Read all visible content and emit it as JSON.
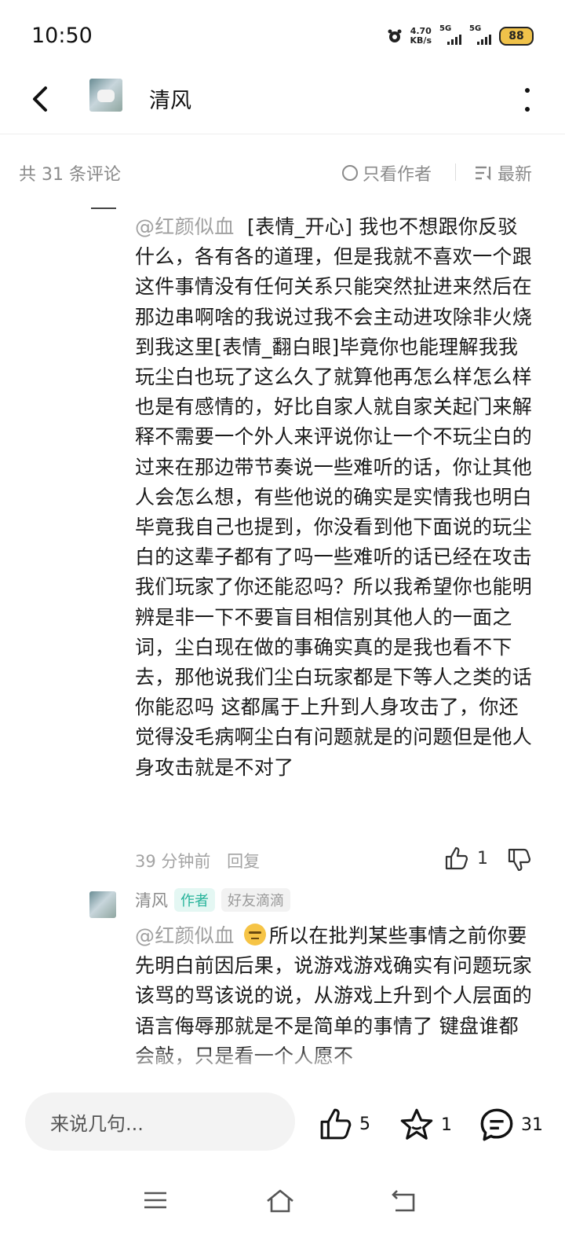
{
  "status_bar": {
    "time": "10:50",
    "speed_value": "4.70",
    "speed_unit": "KB/s",
    "network1": "5G",
    "network2": "5G",
    "battery": "88"
  },
  "header": {
    "title": "清风",
    "back_icon": "back-arrow-icon",
    "more_icon": "more-vertical-icon"
  },
  "filter": {
    "count_label": "共 31 条评论",
    "author_only": "只看作者",
    "sort": "最新"
  },
  "comments": [
    {
      "mention": "@红颜似血",
      "text": "[表情_开心] 我也不想跟你反驳什么，各有各的道理，但是我就不喜欢一个跟这件事情没有任何关系只能突然扯进来然后在那边串啊啥的我说过我不会主动进攻除非火烧到我这里[表情_翻白眼]毕竟你也能理解我我玩尘白也玩了这么久了就算他再怎么样怎么样也是有感情的，好比自家人就自家关起门来解释不需要一个外人来评说你让一个不玩尘白的过来在那边带节奏说一些难听的话，你让其他人会怎么想，有些他说的确实是实情我也明白毕竟我自己也提到，你没看到他下面说的玩尘白的这辈子都有了吗一些难听的话已经在攻击我们玩家了你还能忍吗？所以我希望你也能明辨是非一下不要盲目相信别其他人的一面之词，尘白现在做的事确实真的是我也看不下去，那他说我们尘白玩家都是下等人之类的话你能忍吗 这都属于上升到人身攻击了，你还觉得没毛病啊尘白有问题就是的问题但是他人身攻击就是不对了",
      "time": "39 分钟前",
      "reply_label": "回复",
      "likes": "1"
    },
    {
      "author": "清风",
      "badge_author": "作者",
      "badge_friend": "好友滴滴",
      "mention": "@红颜似血",
      "text": "所以在批判某些事情之前你要先明白前因后果，说游戏游戏确实有问题玩家该骂的骂该说的说，从游戏上升到个人层面的语言侮辱那就是不是简单的事情了 键盘谁都会敲，只是看一个人愿不"
    }
  ],
  "bottom_bar": {
    "placeholder": "来说几句...",
    "likes": "5",
    "favorites": "1",
    "comments": "31"
  },
  "colors": {
    "accent_teal": "#26b39a",
    "muted_text": "#8a8a8a",
    "battery_yellow": "#f0c24a"
  }
}
